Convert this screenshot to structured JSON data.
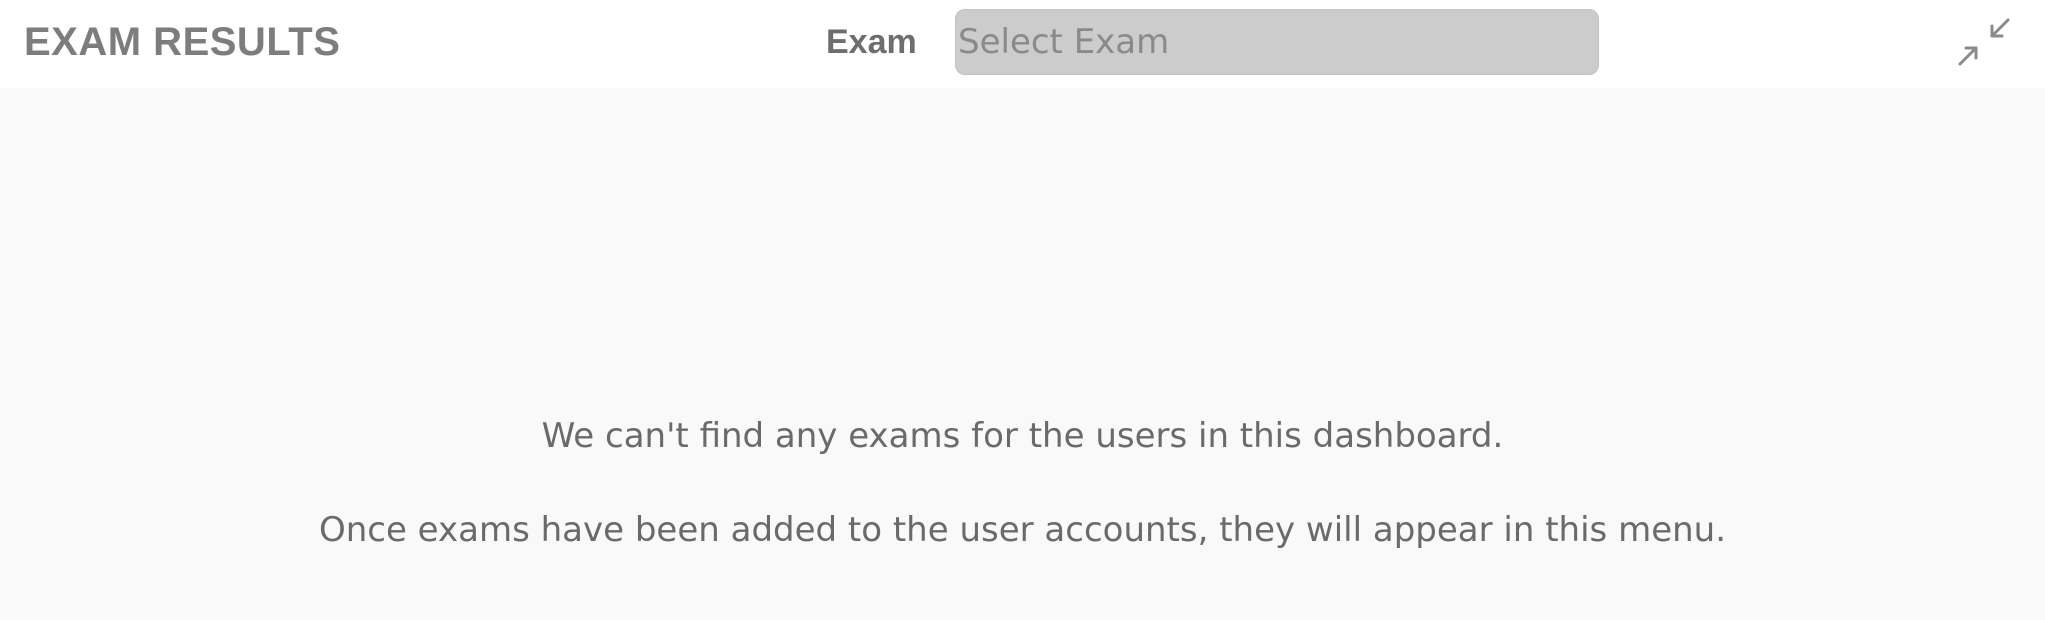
{
  "header": {
    "title": "EXAM RESULTS",
    "exam_label": "Exam",
    "exam_select_placeholder": "Select Exam",
    "collapse_icon": "collapse-arrows-icon"
  },
  "empty_state": {
    "line1": "We can't find any exams for the users in this dashboard.",
    "line2": "Once exams have been added to the user accounts, they will appear in this menu."
  },
  "colors": {
    "header_bg": "#ffffff",
    "content_bg": "#f9f9f9",
    "select_bg": "#cccccc",
    "title_text": "#7d7d7d",
    "body_text": "#6a6a6a"
  }
}
